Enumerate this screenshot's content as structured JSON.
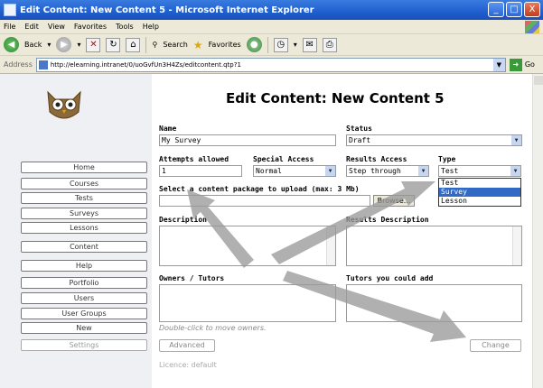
{
  "window": {
    "title": "Edit Content: New Content 5 - Microsoft Internet Explorer",
    "controls": [
      "_",
      "□",
      "X"
    ]
  },
  "menu": [
    "File",
    "Edit",
    "View",
    "Favorites",
    "Tools",
    "Help"
  ],
  "toolbar": {
    "back": "Back",
    "search": "Search",
    "favorites": "Favorites"
  },
  "address": {
    "label": "Address",
    "url": "http://elearning.intranet/0/uoGvfUn3H4Zs/editcontent.qtp?1",
    "go": "Go"
  },
  "sidebar": {
    "items": [
      "Home",
      "Courses",
      "Tests",
      "Surveys",
      "Lessons",
      "Content",
      "Help",
      "Portfolio",
      "Users",
      "User Groups",
      "New",
      "Settings"
    ]
  },
  "form": {
    "heading": "Edit Content: New Content 5",
    "name_label": "Name",
    "name_value": "My Survey",
    "status_label": "Status",
    "status_value": "Draft",
    "attempts_label": "Attempts allowed",
    "attempts_value": "1",
    "special_label": "Special Access",
    "special_value": "Normal",
    "results_access_label": "Results Access",
    "results_access_value": "Step through",
    "type_label": "Type",
    "type_value": "Test",
    "type_options": [
      "Test",
      "Survey",
      "Lesson"
    ],
    "type_selected_option": "Survey",
    "upload_label": "Select a content package to upload (max: 3 Mb)",
    "browse_label": "Browse...",
    "description_label": "Description",
    "results_description_label": "Results Description",
    "owners_label": "Owners / Tutors",
    "tutors_label": "Tutors you could add",
    "hint": "Double-click to move owners.",
    "advanced_label": "Advanced",
    "change_label": "Change",
    "licence": "Licence: default"
  },
  "colors": {
    "sidebar_bg": "#eef0f3",
    "selection": "#316ac5",
    "titlebar": "#1f5fcf"
  }
}
